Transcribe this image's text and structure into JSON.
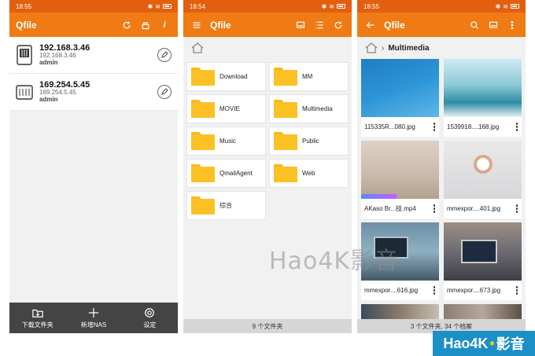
{
  "phone1": {
    "status_time": "18:55",
    "battery": "96",
    "title": "Qfile",
    "nas": [
      {
        "ip": "192.168.3.46",
        "sub": "192.168.3.46",
        "user": "admin"
      },
      {
        "ip": "169.254.5.45",
        "sub": "169.254.5.45",
        "user": "admin"
      }
    ],
    "bottom_nav": [
      "下载文件夹",
      "新增NAS",
      "设定"
    ]
  },
  "phone2": {
    "status_time": "18:54",
    "battery": "96",
    "title": "Qfile",
    "folders": [
      "Download",
      "MM",
      "MOVIE",
      "Multimedia",
      "Music",
      "Public",
      "QmailAgent",
      "Web",
      "综合"
    ],
    "footer": "9 个文件夹"
  },
  "phone3": {
    "status_time": "18:55",
    "battery": "96",
    "title": "Qfile",
    "breadcrumb": "Multimedia",
    "media": [
      {
        "name": "115335R...080.jpg"
      },
      {
        "name": "1539918....168.jpg"
      },
      {
        "name": "AKaso Br...技.mp4"
      },
      {
        "name": "mmexpor....401.jpg"
      },
      {
        "name": "mmexpor....616.jpg"
      },
      {
        "name": "mmexpor....673.jpg"
      }
    ],
    "footer": "3 个文件夹, 34 个档案"
  },
  "watermark": "Hao4K影音",
  "badge": {
    "left": "Hao4K",
    "right": "影音"
  },
  "colors": {
    "appbar": "#f07b14",
    "statusbar": "#e35f10",
    "folder": "#fbc125"
  }
}
